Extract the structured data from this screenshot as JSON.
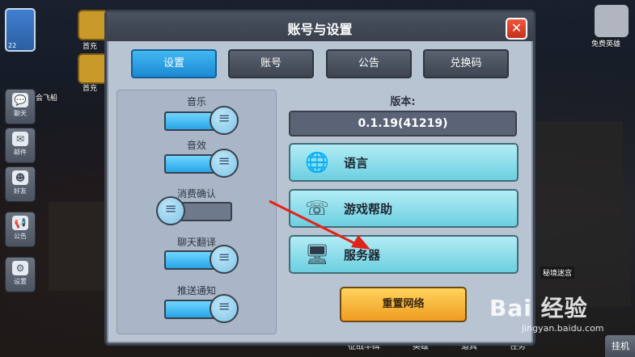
{
  "modal": {
    "title": "账号与设置",
    "close_glyph": "✕"
  },
  "tabs": [
    {
      "label": "设置",
      "active": true
    },
    {
      "label": "账号",
      "active": false
    },
    {
      "label": "公告",
      "active": false
    },
    {
      "label": "兑换码",
      "active": false
    }
  ],
  "settings": [
    {
      "label": "音乐",
      "on": true
    },
    {
      "label": "音效",
      "on": true
    },
    {
      "label": "消费确认",
      "on": false
    },
    {
      "label": "聊天翻译",
      "on": true
    },
    {
      "label": "推送通知",
      "on": true
    }
  ],
  "version": {
    "label": "版本:",
    "value": "0.1.19(41219)"
  },
  "menu": [
    {
      "label": "语言",
      "icon": "globe-icon"
    },
    {
      "label": "游戏帮助",
      "icon": "phone-chat-icon"
    },
    {
      "label": "服务器",
      "icon": "monitor-icon"
    }
  ],
  "reset_label": "重置网络",
  "game_ui": {
    "level": "22",
    "side_buttons": [
      "聊天",
      "邮件",
      "好友",
      "公告",
      "设置"
    ],
    "top_labels": [
      "首充",
      "首充"
    ],
    "airship_label": "会飞船",
    "right_hero_label": "免费英雄",
    "map_label": "秘境迷宫",
    "bottom_tabs": [
      "征战丰碑",
      "英雄",
      "道具",
      "任务"
    ],
    "hang_label": "挂机"
  },
  "watermark": {
    "brand": "Bai 经验",
    "url": "jingyan.baidu.com"
  },
  "colors": {
    "accent": "#1c8ad3",
    "menu": "#6ccfe0",
    "reset": "#f09c22",
    "close": "#c4311d"
  }
}
